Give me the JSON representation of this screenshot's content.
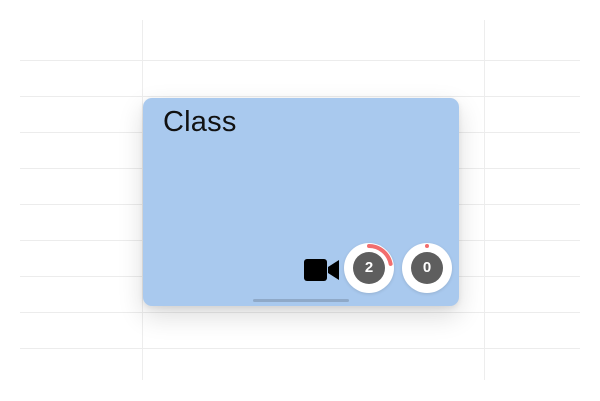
{
  "event": {
    "title": "Class",
    "background_color": "#a9c9ee",
    "video_icon": "video-camera-icon",
    "counters": [
      {
        "value": "2",
        "progress_fraction": 0.22,
        "progress_color": "#f26d6d"
      },
      {
        "value": "0",
        "progress_fraction": 0.0,
        "progress_color": "#f26d6d"
      }
    ]
  }
}
